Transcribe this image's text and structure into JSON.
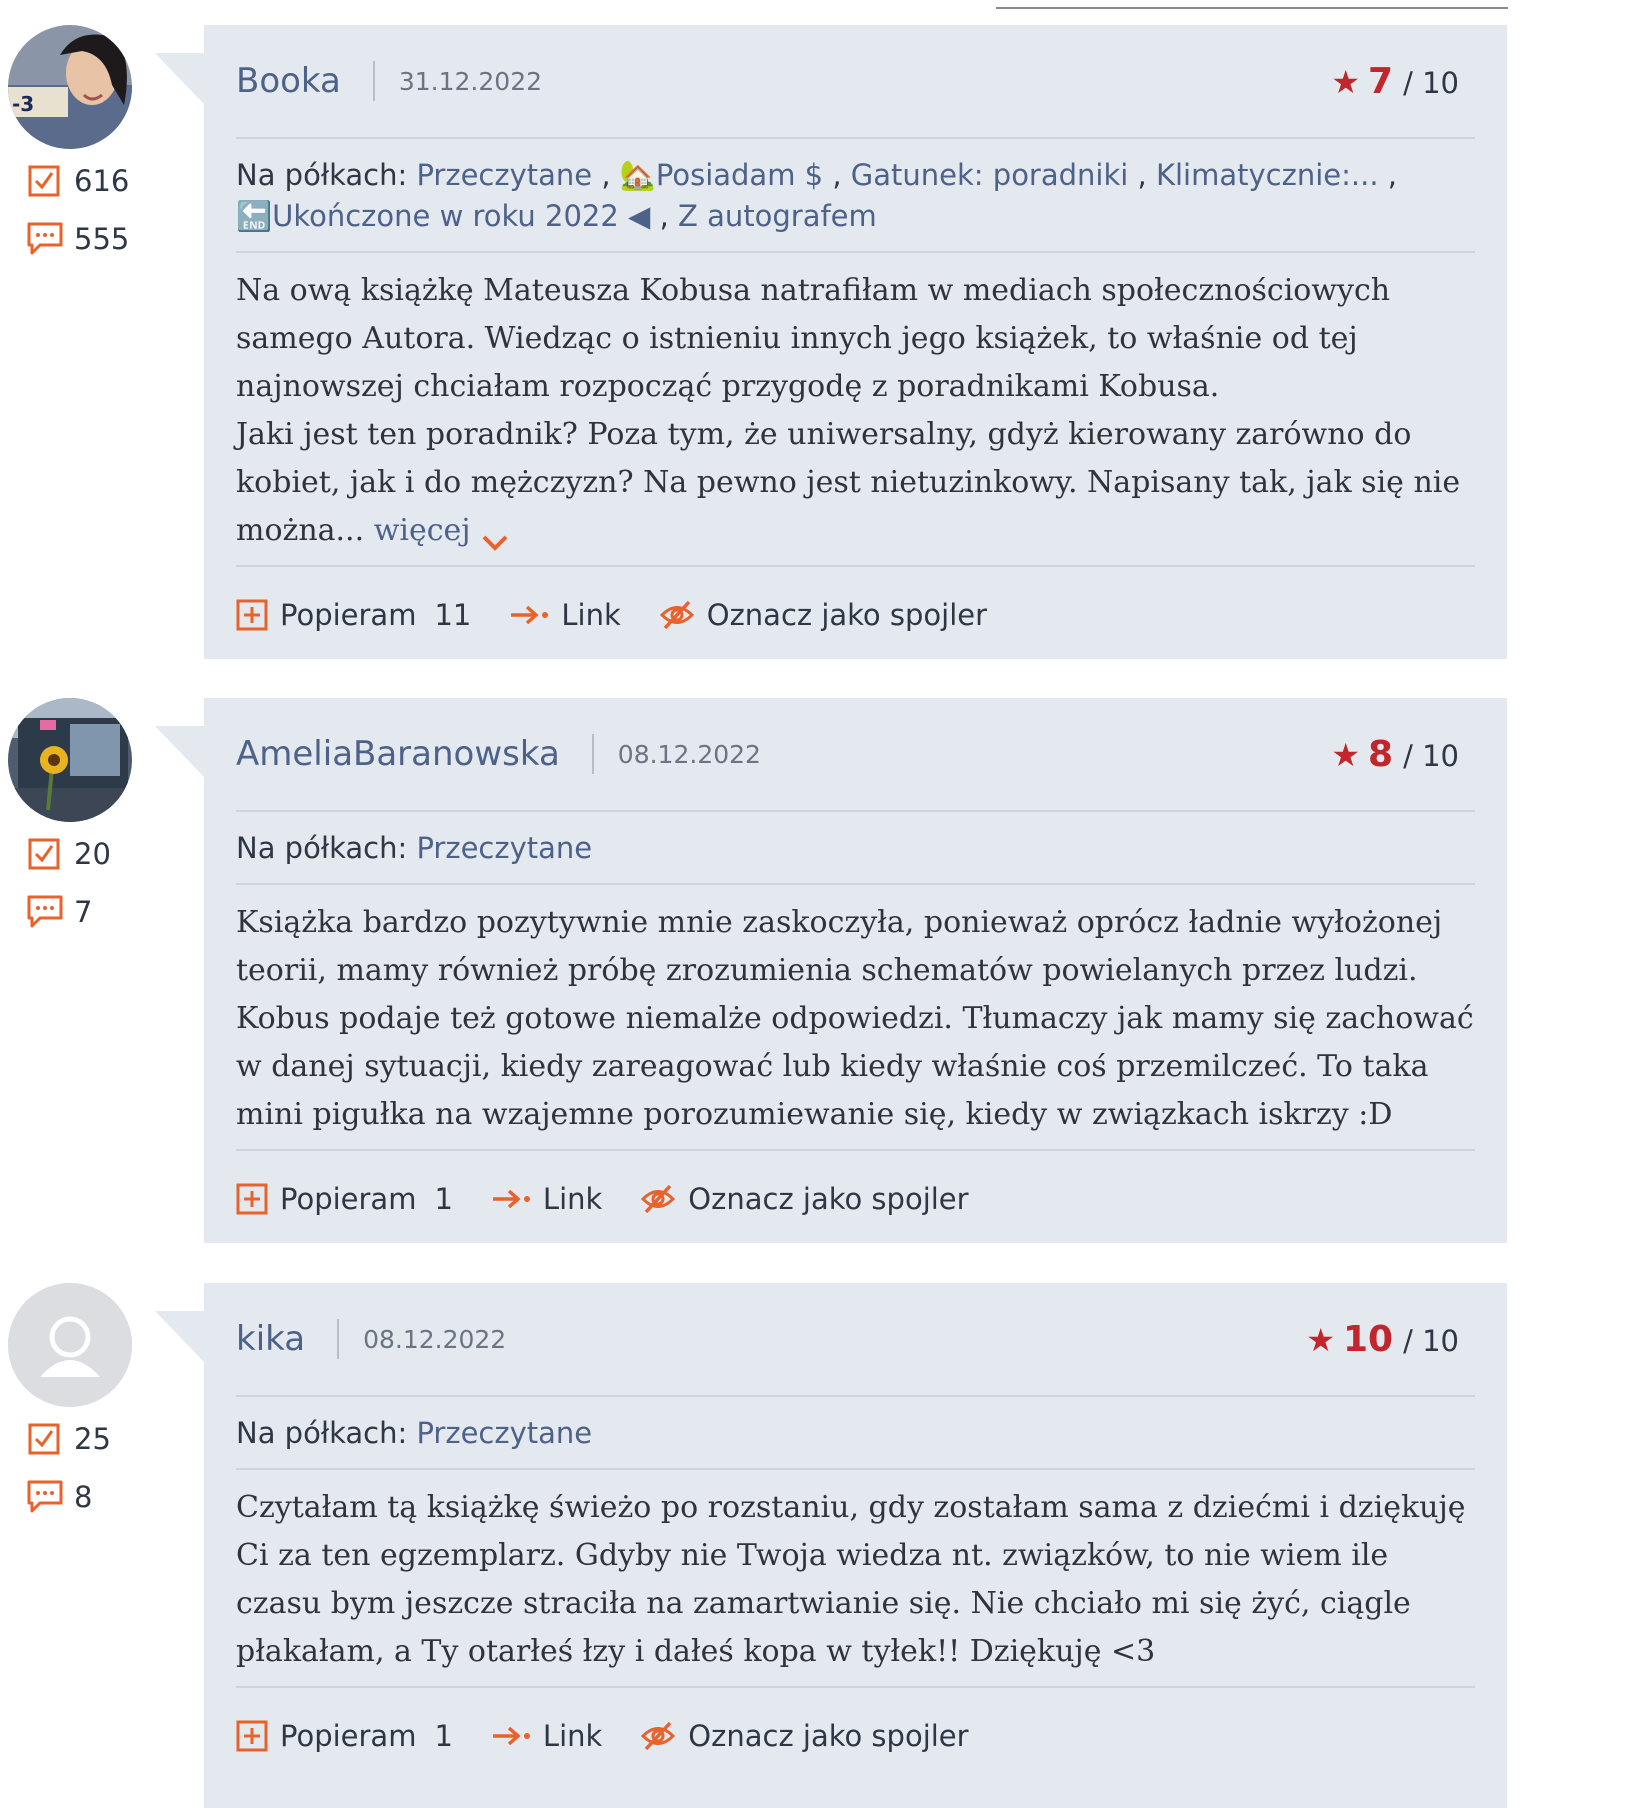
{
  "reviews": [
    {
      "author": "Booka",
      "date": "31.12.2022",
      "rating": "7",
      "rating_max": "/ 10",
      "stats": {
        "read": "616",
        "comments": "555"
      },
      "shelves_label": "Na półkach:",
      "shelves": [
        "Przeczytane",
        "🏡Posiadam $",
        "Gatunek: poradniki",
        "Klimatycznie:...",
        "🔚Ukończone w roku 2022 ◀",
        "Z autografem"
      ],
      "text": "Na ową książkę Mateusza Kobusa natrafiłam w mediach społecznościowych samego Autora. Wiedząc o istnieniu innych jego książek, to właśnie od tej najnowszej chciałam rozpocząć przygodę z poradnikami Kobusa.\nJaki jest ten poradnik? Poza tym, że uniwersalny, gdyż kierowany zarówno do kobiet, jak i do mężczyzn? Na pewno jest nietuzinkowy. Napisany tak, jak się nie można...",
      "more_label": "więcej",
      "support_label": "Popieram",
      "support_count": "11",
      "link_label": "Link",
      "spoiler_label": "Oznacz jako spojler"
    },
    {
      "author": "AmeliaBaranowska",
      "date": "08.12.2022",
      "rating": "8",
      "rating_max": "/ 10",
      "stats": {
        "read": "20",
        "comments": "7"
      },
      "shelves_label": "Na półkach:",
      "shelves": [
        "Przeczytane"
      ],
      "text": "Książka bardzo pozytywnie mnie zaskoczyła, ponieważ oprócz ładnie wyłożonej teorii, mamy również próbę zrozumienia schematów powielanych przez ludzi. Kobus podaje też gotowe niemalże odpowiedzi. Tłumaczy jak mamy się zachować w danej sytuacji, kiedy zareagować lub kiedy właśnie coś przemilczeć. To taka mini pigułka na wzajemne porozumiewanie się, kiedy w związkach iskrzy :D",
      "more_label": "",
      "support_label": "Popieram",
      "support_count": "1",
      "link_label": "Link",
      "spoiler_label": "Oznacz jako spojler"
    },
    {
      "author": "kika",
      "date": "08.12.2022",
      "rating": "10",
      "rating_max": "/ 10",
      "stats": {
        "read": "25",
        "comments": "8"
      },
      "shelves_label": "Na półkach:",
      "shelves": [
        "Przeczytane"
      ],
      "text": "Czytałam tą książkę świeżo po rozstaniu, gdy zostałam sama z dziećmi i dziękuję Ci za ten egzemplarz. Gdyby nie Twoja wiedza nt. związków, to nie wiem ile czasu bym jeszcze straciła na zamartwianie się. Nie chciało mi się żyć, ciągle płakałam, a Ty otarłeś łzy i dałeś kopa w tyłek!! Dziękuję <3",
      "more_label": "",
      "support_label": "Popieram",
      "support_count": "1",
      "link_label": "Link",
      "spoiler_label": "Oznacz jako spojler"
    }
  ],
  "colors": {
    "accent": "#e8622c",
    "link": "#4d6289",
    "rating": "#c0262b",
    "card": "#e4e8ef"
  },
  "icons": {
    "read": "checkbox-icon",
    "comments": "comment-icon",
    "support": "plus-square-icon",
    "link": "arrow-right-icon",
    "spoiler": "eye-slash-icon",
    "rating": "star-icon",
    "more": "chevron-down-icon"
  }
}
